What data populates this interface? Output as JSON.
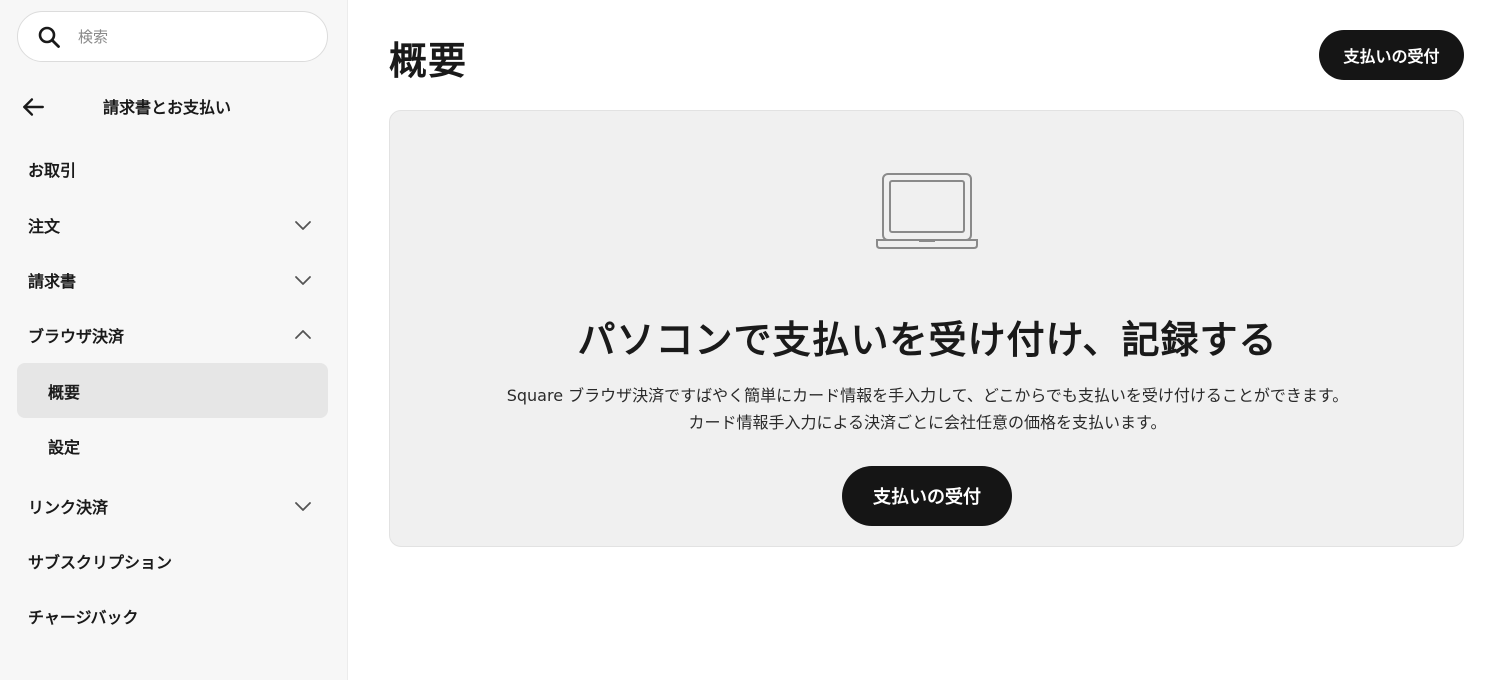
{
  "search": {
    "placeholder": "検索",
    "icon": "search-icon"
  },
  "sidebar": {
    "back_title": "請求書とお支払い",
    "items": [
      {
        "label": "お取引"
      },
      {
        "label": "注文",
        "chevron": "down"
      },
      {
        "label": "請求書",
        "chevron": "down"
      },
      {
        "label": "ブラウザ決済",
        "chevron": "up",
        "expanded": true
      },
      {
        "label": "リンク決済",
        "chevron": "down"
      },
      {
        "label": "サブスクリプション"
      },
      {
        "label": "チャージバック"
      }
    ],
    "subitems": [
      {
        "label": "概要",
        "active": true
      },
      {
        "label": "設定"
      }
    ]
  },
  "main": {
    "title": "概要",
    "header_button": "支払いの受付",
    "card": {
      "icon": "laptop-icon",
      "title": "パソコンで支払いを受け付け、記録する",
      "desc_line1": "Square ブラウザ決済ですばやく簡単にカード情報を手入力して、どこからでも支払いを受け付けることができます。",
      "desc_line2": "カード情報手入力による決済ごとに会社任意の価格を支払います。",
      "button": "支払いの受付"
    }
  },
  "colors": {
    "sidebar_bg": "#f7f7f7",
    "active_item_bg": "#e6e6e6",
    "card_bg": "#f0f0f0",
    "button_bg": "#151515",
    "button_text": "#ffffff"
  }
}
